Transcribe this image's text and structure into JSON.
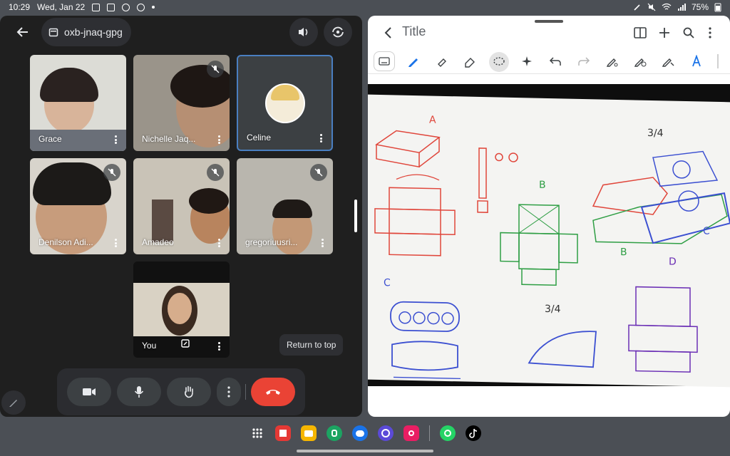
{
  "status_bar": {
    "time": "10:29",
    "date": "Wed, Jan 22",
    "battery": "75%"
  },
  "meet": {
    "meeting_code": "oxb-jnaq-gpg",
    "participants": [
      {
        "name": "Grace",
        "muted": false
      },
      {
        "name": "Nichelle Jaq...",
        "muted": true
      },
      {
        "name": "Celine",
        "muted": false,
        "active_speaker": true
      },
      {
        "name": "Denilson Adi...",
        "muted": true
      },
      {
        "name": "Amadeo",
        "muted": true
      },
      {
        "name": "gregoriuusri...",
        "muted": true
      },
      {
        "name": "You",
        "muted": false
      }
    ],
    "return_to_top": "Return to top",
    "end_call_color": "#ea4335"
  },
  "notes": {
    "title": "Title"
  },
  "taskbar": {
    "apps": [
      "grid-icon",
      "flipboard-icon",
      "files-icon",
      "phone-icon",
      "messages-icon",
      "internet-icon",
      "camera-icon",
      "whatsapp-icon",
      "tiktok-icon"
    ]
  }
}
